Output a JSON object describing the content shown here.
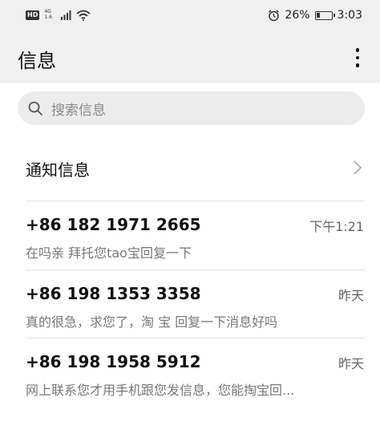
{
  "status_bar": {
    "hd": "HD",
    "net_top": "4G",
    "net_bottom": "1.6",
    "battery_percent": "26%",
    "battery_level": 0.26,
    "time": "3:03"
  },
  "header": {
    "title": "信息"
  },
  "search": {
    "placeholder": "搜索信息"
  },
  "notifications_row": {
    "label": "通知信息"
  },
  "messages": [
    {
      "sender": "+86 182 1971 2665",
      "time": "下午1:21",
      "preview": "在吗亲  拜托您tao宝回复一下"
    },
    {
      "sender": "+86 198 1353 3358",
      "time": "昨天",
      "preview": "真的很急，求您了，淘  宝  回复一下消息好吗"
    },
    {
      "sender": "+86 198 1958 5912",
      "time": "昨天",
      "preview": "网上联系您才用手机跟您发信息，您能掏宝回..."
    }
  ]
}
